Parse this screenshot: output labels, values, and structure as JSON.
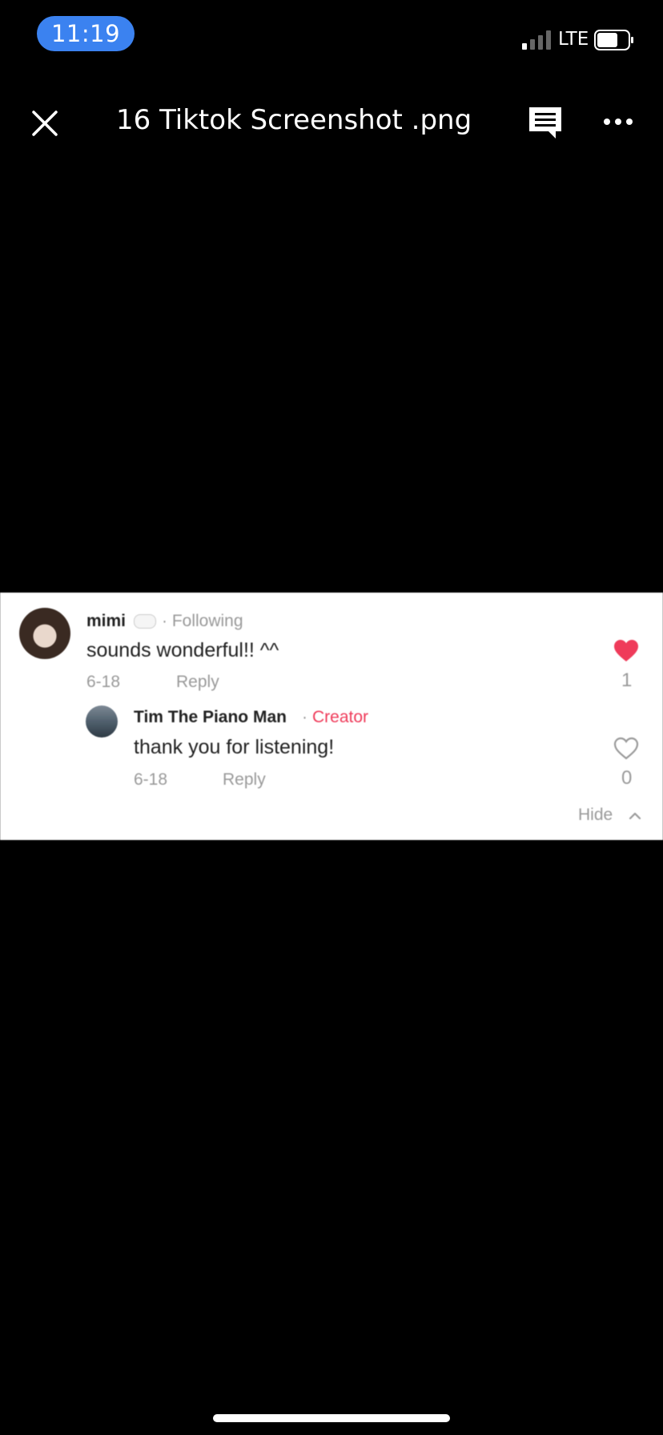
{
  "status_bar": {
    "time": "11:19",
    "network": "LTE"
  },
  "top_bar": {
    "title": "16 Tiktok Screenshot .png"
  },
  "comments": [
    {
      "username": "mimi",
      "relation": "· Following",
      "text": "sounds wonderful!! ^^",
      "date": "6-18",
      "reply_label": "Reply",
      "likes": "1",
      "liked": true
    },
    {
      "username": "Tim The Piano Man",
      "separator": "·",
      "badge": "Creator",
      "text": "thank you for listening!",
      "date": "6-18",
      "reply_label": "Reply",
      "likes": "0",
      "liked": false
    }
  ],
  "hide_label": "Hide",
  "colors": {
    "accent_blue": "#3b82f0",
    "heart_red": "#ef3b5a",
    "muted_gray": "#9a9a9a"
  },
  "icons": [
    "close-icon",
    "comment-icon",
    "more-icon",
    "heart-icon",
    "heart-outline-icon",
    "chevron-up-icon",
    "cloud-icon"
  ]
}
